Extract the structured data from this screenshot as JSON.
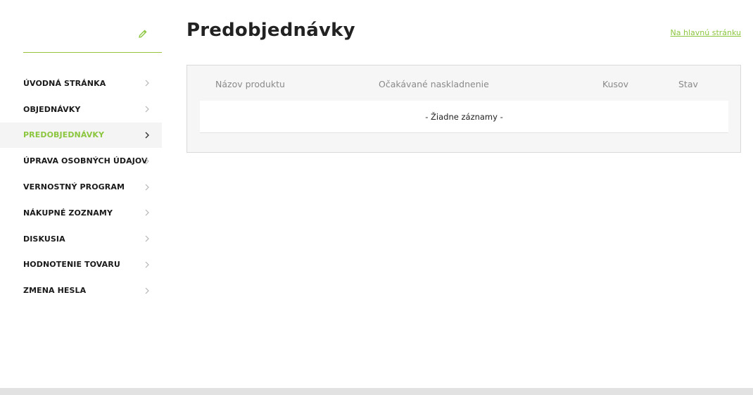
{
  "sidebar": {
    "edit_icon": "pencil-icon",
    "items": [
      {
        "label": "ÚVODNÁ STRÁNKA",
        "active": false
      },
      {
        "label": "OBJEDNÁVKY",
        "active": false
      },
      {
        "label": "PREDOBJEDNÁVKY",
        "active": true
      },
      {
        "label": "ÚPRAVA OSOBNÝCH ÚDAJOV",
        "active": false
      },
      {
        "label": "VERNOSTNÝ PROGRAM",
        "active": false
      },
      {
        "label": "NÁKUPNÉ ZOZNAMY",
        "active": false
      },
      {
        "label": "DISKUSIA",
        "active": false
      },
      {
        "label": "HODNOTENIE TOVARU",
        "active": false
      },
      {
        "label": "ZMENA HESLA",
        "active": false
      }
    ]
  },
  "main": {
    "title": "Predobjednávky",
    "home_link": "Na hlavnú stránku",
    "table": {
      "columns": [
        "Názov produktu",
        "Očakávané naskladnenie",
        "Kusov",
        "Stav"
      ],
      "empty_message": "- Žiadne záznamy -"
    }
  },
  "colors": {
    "accent": "#8cc63f",
    "active_bg": "#f4f4f4",
    "panel_bg": "#f6f6f6",
    "header_text": "#8a8a8a"
  }
}
